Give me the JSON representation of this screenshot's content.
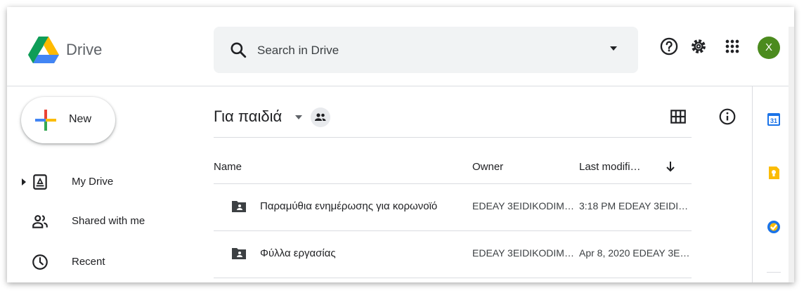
{
  "header": {
    "app_name": "Drive",
    "search_placeholder": "Search in Drive",
    "avatar_letter": "X",
    "icons": [
      "drive-logo-icon",
      "search-icon",
      "dropdown-icon",
      "help-icon",
      "settings-icon",
      "apps-icon"
    ]
  },
  "sidebar": {
    "new_label": "New",
    "items": [
      {
        "label": "My Drive",
        "icon": "my-drive-icon"
      },
      {
        "label": "Shared with me",
        "icon": "shared-icon"
      },
      {
        "label": "Recent",
        "icon": "recent-icon"
      }
    ]
  },
  "main": {
    "folder_title": "Για παιδιά",
    "columns": {
      "name": "Name",
      "owner": "Owner",
      "modified": "Last modifi…"
    },
    "rows": [
      {
        "name": "Παραμύθια ενημέρωσης για κορωνοϊό",
        "owner": "EDEAY 3EIDIKODIMPA…",
        "modified": "3:18 PM EDEAY 3EIDIK…"
      },
      {
        "name": "Φύλλα εργασίας",
        "owner": "EDEAY 3EIDIKODIMPA…",
        "modified": "Apr 8, 2020 EDEAY 3EI…"
      }
    ]
  },
  "right_panel": {
    "calendar_day": "31",
    "icons": [
      "calendar-icon",
      "keep-icon",
      "tasks-icon"
    ]
  },
  "colors": {
    "accent_blue": "#1a73e8",
    "avatar_green": "#4b8b1e",
    "keep_yellow": "#fbbc04"
  }
}
